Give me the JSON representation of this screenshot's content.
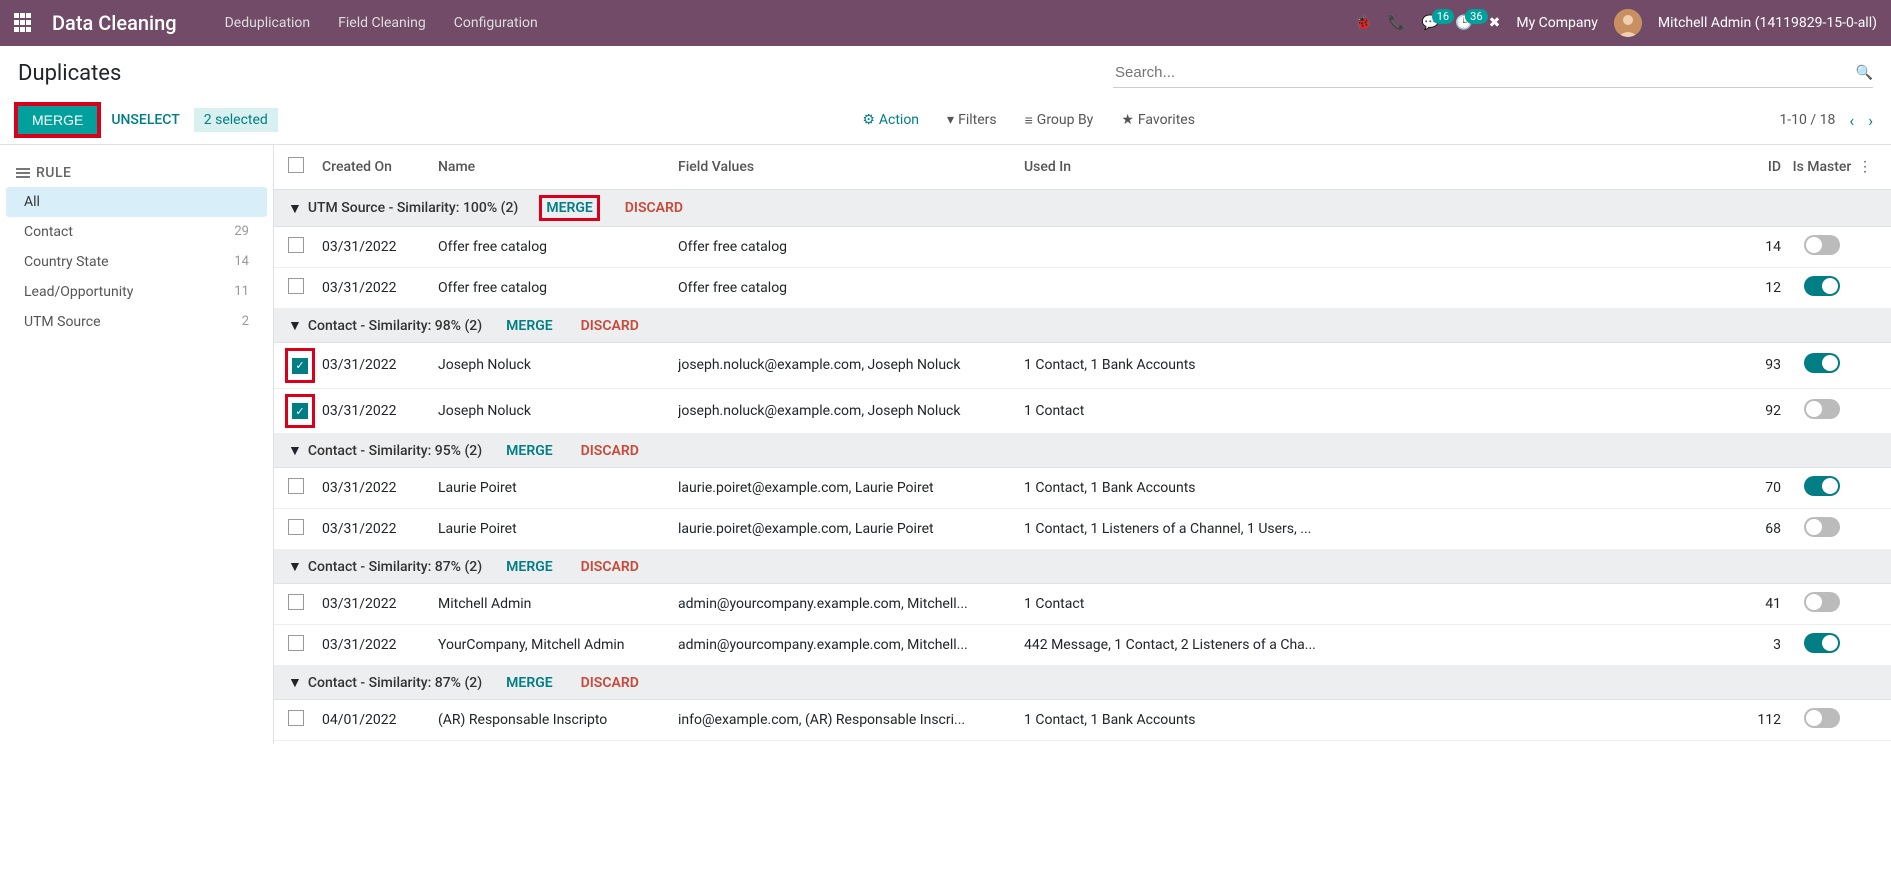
{
  "topbar": {
    "app_title": "Data Cleaning",
    "menu": [
      "Deduplication",
      "Field Cleaning",
      "Configuration"
    ],
    "msg_badge": "16",
    "act_badge": "36",
    "company": "My Company",
    "user": "Mitchell Admin (14119829-15-0-all)"
  },
  "breadcrumb": "Duplicates",
  "search_placeholder": "Search...",
  "toolbar": {
    "merge": "MERGE",
    "unselect": "UNSELECT",
    "selected": "2 selected",
    "action": "Action",
    "filters": "Filters",
    "groupby": "Group By",
    "favorites": "Favorites",
    "pager": "1-10 / 18"
  },
  "sidebar": {
    "header": "RULE",
    "items": [
      {
        "label": "All",
        "count": "",
        "active": true
      },
      {
        "label": "Contact",
        "count": "29"
      },
      {
        "label": "Country State",
        "count": "14"
      },
      {
        "label": "Lead/Opportunity",
        "count": "11"
      },
      {
        "label": "UTM Source",
        "count": "2"
      }
    ]
  },
  "columns": {
    "created": "Created On",
    "name": "Name",
    "fv": "Field Values",
    "used": "Used In",
    "id": "ID",
    "master": "Is Master"
  },
  "grp_btn": {
    "merge": "MERGE",
    "discard": "DISCARD"
  },
  "groups": [
    {
      "title": "UTM Source - Similarity: 100% (2)",
      "merge_hl": true,
      "rows": [
        {
          "chk": false,
          "date": "03/31/2022",
          "name": "Offer free catalog",
          "fv": "Offer free catalog",
          "used": "",
          "id": "14",
          "master": false
        },
        {
          "chk": false,
          "date": "03/31/2022",
          "name": "Offer free catalog",
          "fv": "Offer free catalog",
          "used": "",
          "id": "12",
          "master": true
        }
      ]
    },
    {
      "title": "Contact - Similarity: 98% (2)",
      "rows_hl": true,
      "rows": [
        {
          "chk": true,
          "date": "03/31/2022",
          "name": "Joseph Noluck",
          "fv": "joseph.noluck@example.com, Joseph Noluck",
          "used": "1 Contact, 1 Bank Accounts",
          "id": "93",
          "master": true
        },
        {
          "chk": true,
          "date": "03/31/2022",
          "name": "Joseph Noluck",
          "fv": "joseph.noluck@example.com, Joseph Noluck",
          "used": "1 Contact",
          "id": "92",
          "master": false
        }
      ]
    },
    {
      "title": "Contact - Similarity: 95% (2)",
      "rows": [
        {
          "chk": false,
          "date": "03/31/2022",
          "name": "Laurie Poiret",
          "fv": "laurie.poiret@example.com, Laurie Poiret",
          "used": "1 Contact, 1 Bank Accounts",
          "id": "70",
          "master": true
        },
        {
          "chk": false,
          "date": "03/31/2022",
          "name": "Laurie Poiret",
          "fv": "laurie.poiret@example.com, Laurie Poiret",
          "used": "1 Contact, 1 Listeners of a Channel, 1 Users, ...",
          "id": "68",
          "master": false
        }
      ]
    },
    {
      "title": "Contact - Similarity: 87% (2)",
      "rows": [
        {
          "chk": false,
          "date": "03/31/2022",
          "name": "Mitchell Admin",
          "fv": "admin@yourcompany.example.com, Mitchell...",
          "used": "1 Contact",
          "id": "41",
          "master": false
        },
        {
          "chk": false,
          "date": "03/31/2022",
          "name": "YourCompany, Mitchell Admin",
          "fv": "admin@yourcompany.example.com, Mitchell...",
          "used": "442 Message, 1 Contact, 2 Listeners of a Cha...",
          "id": "3",
          "master": true
        }
      ]
    },
    {
      "title": "Contact - Similarity: 87% (2)",
      "rows": [
        {
          "chk": false,
          "date": "04/01/2022",
          "name": "(AR) Responsable Inscripto",
          "fv": "info@example.com, (AR) Responsable Inscri...",
          "used": "1 Contact, 1 Bank Accounts",
          "id": "112",
          "master": false
        }
      ]
    }
  ]
}
